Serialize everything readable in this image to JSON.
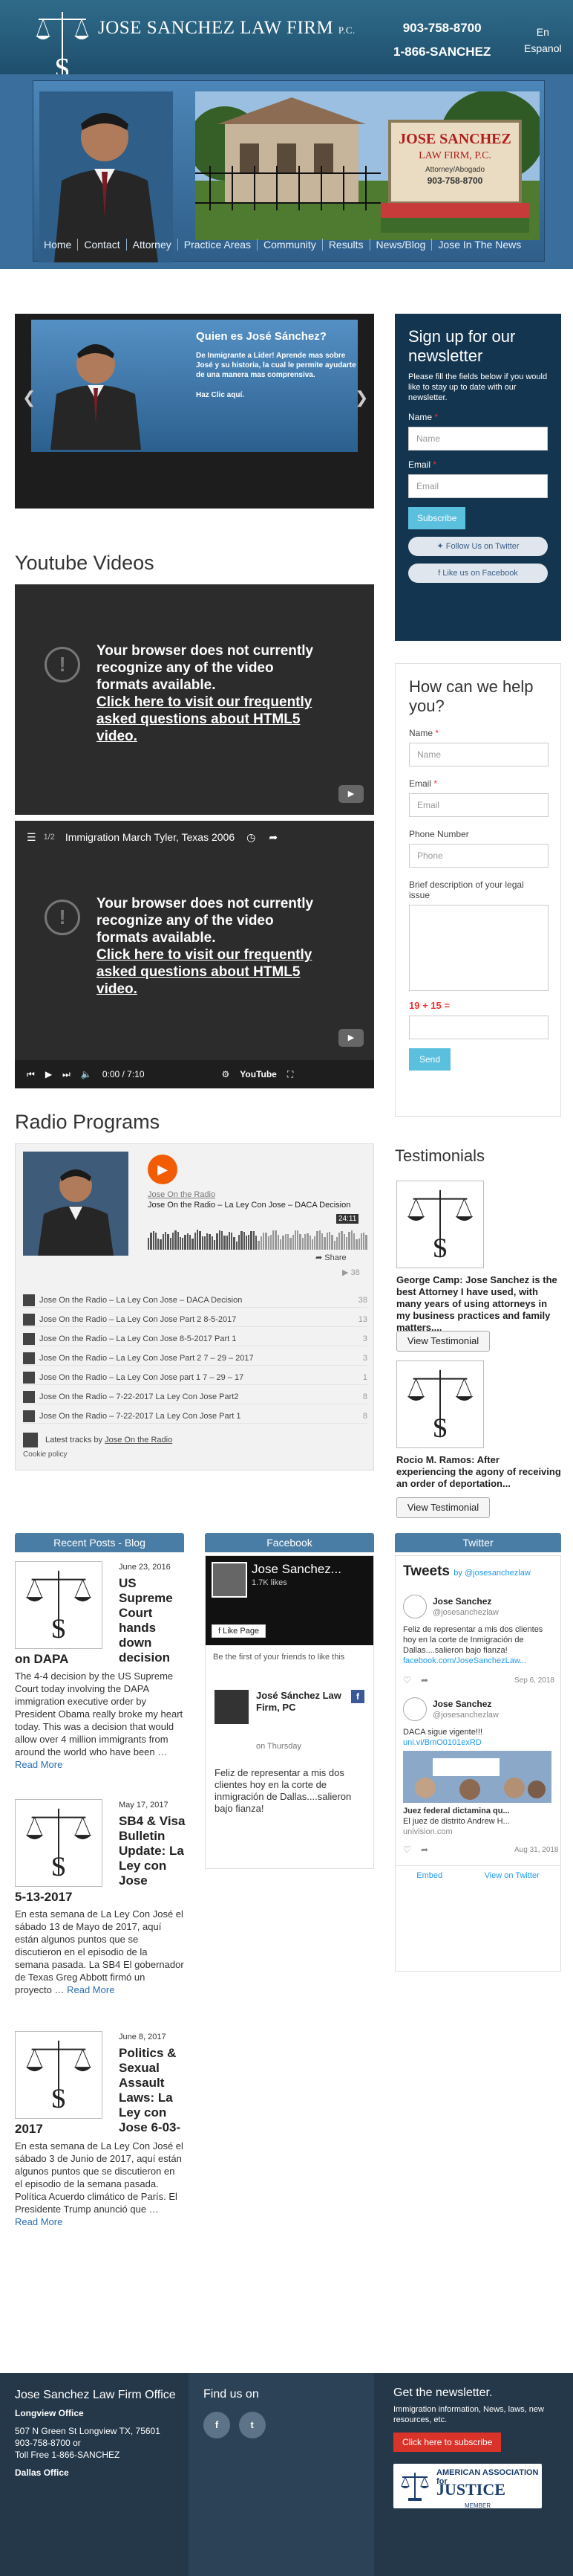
{
  "header": {
    "firm_name": "JOSE SANCHEZ LAW FIRM",
    "firm_suffix": "P.C.",
    "phone1": "903-758-8700",
    "phone2": "1-866-SANCHEZ",
    "lang_en": "En",
    "lang_es": "Espanol"
  },
  "office_sign": {
    "line1": "JOSE SANCHEZ",
    "line2": "LAW FIRM, P.C.",
    "line3": "Attorney/Abogado",
    "line4": "903-758-8700"
  },
  "nav": [
    "Home",
    "Contact",
    "Attorney",
    "Practice Areas",
    "Community",
    "Results",
    "News/Blog",
    "Jose In The News"
  ],
  "slider": {
    "title": "Quien es José Sánchez?",
    "text": "De Inmigrante a Líder! Aprende mas sobre José y su historia, la cual le permite ayudarte de una manera mas comprensiva.",
    "link": "Haz Clic aquí."
  },
  "youtube": {
    "heading": "Youtube Videos",
    "error_line1": "Your browser does not currently",
    "error_line2": "recognize any of the video",
    "error_line3": "formats available.",
    "error_link1": "Click here to visit our frequently",
    "error_link2": "asked questions about HTML5",
    "error_link3": "video.",
    "playlist_count": "1/2",
    "video2_title": "Immigration March Tyler, Texas 2006",
    "time": "0:00 / 7:10",
    "yt_label": "YouTube"
  },
  "radio": {
    "heading": "Radio Programs",
    "show": "Jose On the Radio",
    "track_now": "Jose On the Radio – La Ley Con Jose – DACA Decision",
    "duration": "24:11",
    "share": "Share",
    "plays_now": "38",
    "tracks": [
      {
        "title": "Jose On the Radio – La Ley Con Jose – DACA Decision",
        "plays": "38"
      },
      {
        "title": "Jose On the Radio – La Ley Con Jose Part 2 8-5-2017",
        "plays": "13"
      },
      {
        "title": "Jose On the Radio – La Ley Con Jose 8-5-2017 Part 1",
        "plays": "3"
      },
      {
        "title": "Jose On the Radio – La Ley Con Jose Part 2 7 – 29 – 2017",
        "plays": "3"
      },
      {
        "title": "Jose On the Radio – La Ley Con Jose part 1 7 – 29 – 17",
        "plays": "1"
      },
      {
        "title": "Jose On the Radio – 7-22-2017 La Ley Con Jose Part2",
        "plays": "8"
      },
      {
        "title": "Jose On the Radio – 7-22-2017 La Ley Con Jose Part 1",
        "plays": "8"
      }
    ],
    "latest_prefix": "Latest tracks by",
    "latest_link": "Jose On the Radio",
    "cookie": "Cookie policy"
  },
  "newsletter": {
    "title": "Sign up for our newsletter",
    "desc": "Please fill the fields below if you would like to stay up to date with our newsletter.",
    "name_label": "Name",
    "name_ph": "Name",
    "email_label": "Email",
    "email_ph": "Email",
    "subscribe": "Subscribe",
    "twitter": "Follow Us on Twitter",
    "facebook": "Like us on Facebook"
  },
  "help_form": {
    "title": "How can we help you?",
    "name_label": "Name",
    "name_ph": "Name",
    "email_label": "Email",
    "email_ph": "Email",
    "phone_label": "Phone Number",
    "phone_ph": "Phone",
    "desc_label": "Brief description of your legal issue",
    "captcha": "19 + 15 =",
    "send": "Send"
  },
  "testimonials": {
    "heading": "Testimonials",
    "items": [
      {
        "text": "George Camp: Jose Sanchez is the best Attorney I have used, with many years of using attorneys in my business practices and family matters....",
        "button": "View Testimonial"
      },
      {
        "text": "Rocio M. Ramos: After experiencing the agony of receiving an order of deportation...",
        "button": "View Testimonial"
      }
    ]
  },
  "blog": {
    "heading": "Recent Posts - Blog",
    "posts": [
      {
        "date": "June 23, 2016",
        "title": "US Supreme Court hands down decision",
        "title_tail": "on DAPA",
        "body": "The 4-4 decision by the US Supreme Court today involving the DAPA immigration executive order by President Obama really broke my heart today. This was a decision that would allow over 4 million immigrants from around the world who have been …",
        "more": "Read More"
      },
      {
        "date": "May 17, 2017",
        "title": "SB4 & Visa Bulletin Update: La Ley con Jose",
        "title_tail": "5-13-2017",
        "body": "En esta semana de La Ley Con José el sábado 13 de Mayo de 2017, aquí están algunos puntos que se discutieron en el episodio de la semana pasada. La SB4 El gobernador de Texas Greg Abbott firmó un proyecto …",
        "more": "Read More"
      },
      {
        "date": "June 8, 2017",
        "title": "Politics & Sexual Assault Laws: La Ley con Jose 6-03-",
        "title_tail": "2017",
        "body": "En esta semana de La Ley Con José el sábado 3 de Junio de 2017, aquí están algunos puntos que se discutieron en el episodio de la semana pasada.  Política Acuerdo climático de París. El Presidente Trump anunció que …",
        "more": "Read More"
      }
    ]
  },
  "facebook": {
    "heading": "Facebook",
    "page_name": "Jose Sanchez...",
    "likes": "1.7K likes",
    "like_btn": "Like Page",
    "first": "Be the first of your friends to like this",
    "post_name": "José Sánchez Law Firm, PC",
    "post_time": "on Thursday",
    "post_text": "Feliz de representar a mis dos clientes hoy en la corte de inmigración de Dallas....salieron bajo fianza!"
  },
  "twitter": {
    "heading": "Twitter",
    "title": "Tweets",
    "by": "by @josesanchezlaw",
    "tweets": [
      {
        "name": "Jose Sanchez",
        "handle": "@josesanchezlaw",
        "text": "Feliz de representar a mis dos clientes hoy en la corte de Inmigración de Dallas....salieron bajo fianza!",
        "link": "facebook.com/JoseSanchezLaw...",
        "date": "Sep 6, 2018"
      },
      {
        "name": "Jose Sanchez",
        "handle": "@josesanchezlaw",
        "text": "DACA sigue vigente!!!",
        "link": "uni.vi/BmO0101exRD",
        "card_title": "Juez federal dictamina qu...",
        "card_text": "El juez de distrito Andrew H...",
        "card_src": "univision.com",
        "date": "Aug 31, 2018"
      }
    ],
    "embed": "Embed",
    "view": "View on Twitter"
  },
  "footer": {
    "firm": "Jose Sanchez Law Firm Office",
    "office1": "Longview Office",
    "addr1": "507 N Green St Longview TX, 75601",
    "phone": "903-758-8700 or",
    "tollfree": "Toll Free 1-866-SANCHEZ",
    "office2": "Dallas Office",
    "find": "Find us on",
    "fb": "f",
    "tw": "t",
    "news_title": "Get the newsletter.",
    "news_desc": "Immigration information, News, laws, new resources, etc.",
    "news_btn": "Click here to subscribe",
    "aaj1": "AMERICAN ASSOCIATION for",
    "aaj2": "JUSTICE",
    "aaj3": "MEMBER"
  },
  "colors": {
    "header": "#2f6b8a",
    "footer": "#24384a",
    "newsletter": "#13354f",
    "accent": "#5bc0de",
    "radio_play": "#f25c05"
  }
}
